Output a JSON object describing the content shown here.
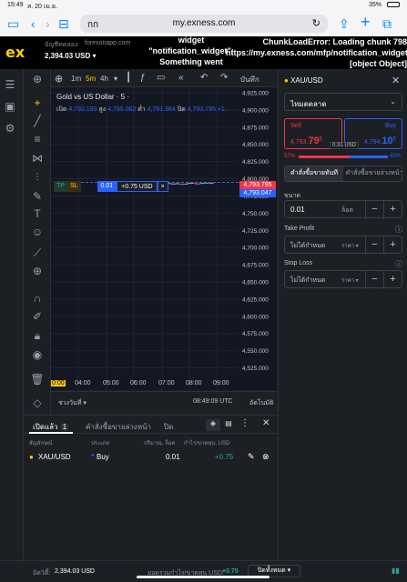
{
  "status": {
    "time": "15:49",
    "date": "ส. 20 เม.ย.",
    "battery": "35%"
  },
  "browser": {
    "aa_label": "กก",
    "url": "my.exness.com"
  },
  "header": {
    "logo": "ex",
    "account_badge": "บัญชีทดลอง",
    "account_domain": "forexonapp.com",
    "balance": "2,394.03 USD",
    "error_left": "widget\n\"notification_widget\":\nSomething went\nwrong",
    "error_right": "ChunkLoadError: Loading chunk 798\nhttps://my.exness.com/mfp/notification_widget\n[object Object]"
  },
  "chart_toolbar": {
    "timeframes": [
      "1m",
      "5m",
      "4h"
    ],
    "active_timeframe": "5m",
    "save_label": "บันทึก",
    "save_sub": "บันทึก"
  },
  "chart": {
    "title": "Gold vs US Dollar · 5 ·",
    "ohlc": {
      "open_label": "เปิด",
      "open": "4,792.193",
      "high_label": "สูง",
      "high": "4,795.062",
      "low_label": "ต่ำ",
      "low": "4,791.984",
      "close_label": "ปิด",
      "close": "4,793.795",
      "change": "+1..."
    },
    "position_line": {
      "tp": "TP",
      "sl": "SL",
      "lots": "0.01",
      "pnl": "+0.75 USD",
      "close": "×"
    },
    "price_tags": {
      "ask": "4,793.795",
      "bid": "4,793.047"
    },
    "x_labels": [
      "0:00",
      "04:00",
      "05:00",
      "06:00",
      "07:00",
      "08:00",
      "09:00"
    ],
    "range_label": "ช่วงวันที่",
    "clock": "08:49:09 UTC",
    "auto_label": "อัตโนมัติ"
  },
  "chart_data": {
    "type": "line",
    "title": "Gold vs US Dollar · 5 ·",
    "ylabel": "",
    "ylim": [
      4512.5,
      4925
    ],
    "y_ticks": [
      4925.0,
      4900.0,
      4875.0,
      4850.0,
      4825.0,
      4800.0,
      4775.0,
      4750.0,
      4725.0,
      4700.0,
      4675.0,
      4650.0,
      4625.0,
      4600.0,
      4575.0,
      4550.0,
      4525.0
    ],
    "series": [
      {
        "values": [
          4793.2,
          4792.4,
          4794.1,
          4793.0,
          4791.8,
          4792.6,
          4793.9,
          4795.2,
          4796.5,
          4794.2,
          4792.8,
          4793.5,
          4791.9,
          4793.0,
          4792.4,
          4791.6,
          4792.9,
          4793.8,
          4793.1,
          4792.2,
          4793.6,
          4794.0,
          4793.4,
          4793.8
        ]
      }
    ]
  },
  "symbol": {
    "name": "XAU/USD",
    "order_type": "ไหมดตลาด",
    "sell_label": "Sell",
    "sell_price": "4,793.",
    "sell_big": "79",
    "sell_sup": "5",
    "buy_label": "Buy",
    "buy_price": "4,794.",
    "buy_big": "10",
    "buy_sup": "5",
    "spread": "0.31 USD",
    "sell_pct": "57%",
    "buy_pct": "43%",
    "sell_pct_value": 57,
    "tab_market": "คำสั่งซื้อขายทันที",
    "tab_pending": "คำสั่งซื้อขายล่วงหน้า",
    "size_label": "ขนาด",
    "size_value": "0.01",
    "size_unit": "ล็อต",
    "tp_label": "Take Profit",
    "tp_value": "ไม่ได้กำหนด",
    "tp_unit": "ราคา",
    "sl_label": "Stop Loss",
    "sl_value": "ไม่ได้กำหนด",
    "sl_unit": "ราคา"
  },
  "positions": {
    "tab_open": "เปิดแล้ว",
    "open_count": "1",
    "tab_pending": "คำสั่งซื้อขายล่วงหน้า",
    "tab_closed": "ปิด",
    "col_symbol": "สัญลักษณ์",
    "col_type": "ประเภท",
    "col_volume": "ปริมาณ, ล็อต",
    "col_pnl": "กำไร/ขาดทุน, USD",
    "rows": [
      {
        "symbol": "XAU/USD",
        "type": "Buy",
        "volume": "0.01",
        "pnl": "+0.75"
      }
    ]
  },
  "footer": {
    "equity_label": "อิควิตี้:",
    "equity": "2,394.03 USD",
    "total_pnl_label": "ยอดรวมกำไร/ขาดทุน USD:",
    "total_pnl": "+0.75",
    "close_all": "ปิดทั้งหมด"
  },
  "colors": {
    "sell": "#f23645",
    "buy": "#2962ff",
    "profit": "#26a69a",
    "accent": "#ffcf00"
  }
}
